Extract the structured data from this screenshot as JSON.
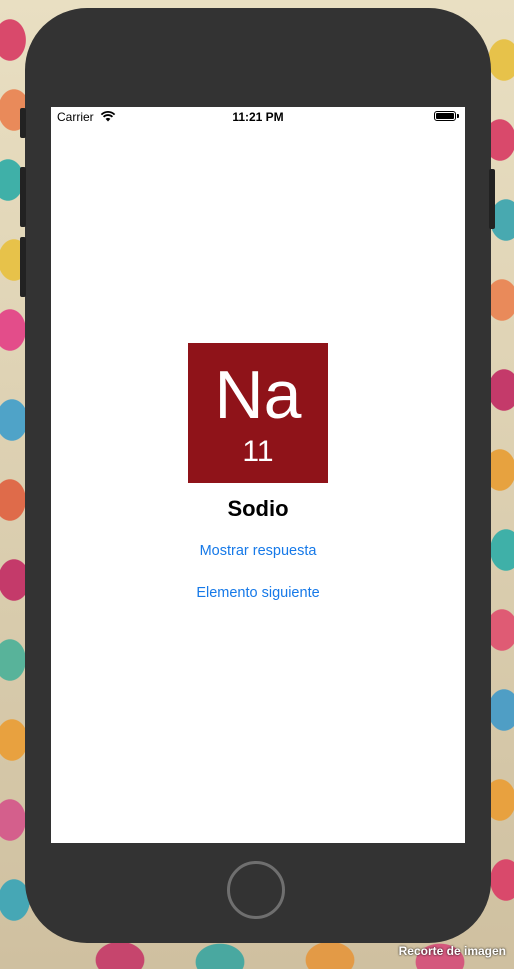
{
  "status_bar": {
    "carrier": "Carrier",
    "time": "11:21 PM",
    "wifi_icon": "wifi-icon",
    "battery_icon": "battery-icon"
  },
  "element_card": {
    "symbol": "Na",
    "atomic_number": "11",
    "name": "Sodio",
    "tile_color": "#8f1319"
  },
  "actions": {
    "show_answer": "Mostrar respuesta",
    "next_element": "Elemento siguiente",
    "link_color": "#1679e8"
  },
  "watermark": {
    "caption": "Recorte de imagen"
  }
}
